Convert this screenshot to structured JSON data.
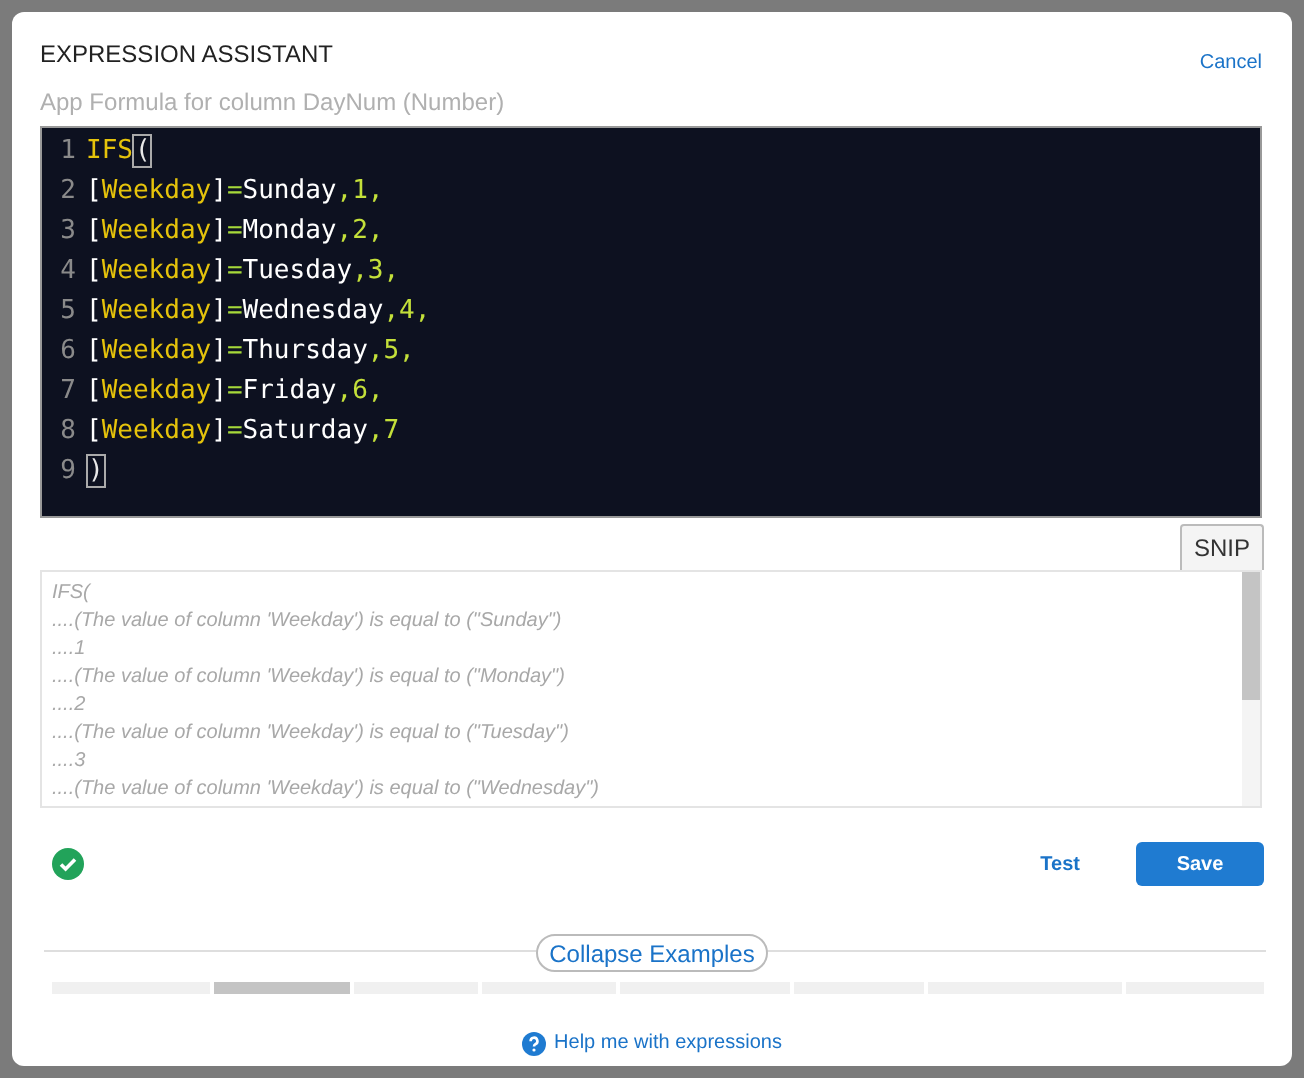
{
  "dialog": {
    "title": "EXPRESSION ASSISTANT",
    "cancel": "Cancel",
    "subtitle": "App Formula for column DayNum (Number)"
  },
  "editor": {
    "lines": [
      {
        "number": "1",
        "tokens": [
          {
            "kind": "function",
            "text": "IFS"
          },
          {
            "kind": "paren",
            "text": "(",
            "highlighted": true
          }
        ]
      },
      {
        "number": "2",
        "tokens": [
          {
            "kind": "plain",
            "text": "["
          },
          {
            "kind": "column",
            "text": "Weekday"
          },
          {
            "kind": "plain",
            "text": "]"
          },
          {
            "kind": "operator",
            "text": "="
          },
          {
            "kind": "plain",
            "text": "Sunday"
          },
          {
            "kind": "number",
            "text": ",1,"
          }
        ]
      },
      {
        "number": "3",
        "tokens": [
          {
            "kind": "plain",
            "text": "["
          },
          {
            "kind": "column",
            "text": "Weekday"
          },
          {
            "kind": "plain",
            "text": "]"
          },
          {
            "kind": "operator",
            "text": "="
          },
          {
            "kind": "plain",
            "text": "Monday"
          },
          {
            "kind": "number",
            "text": ",2,"
          }
        ]
      },
      {
        "number": "4",
        "tokens": [
          {
            "kind": "plain",
            "text": "["
          },
          {
            "kind": "column",
            "text": "Weekday"
          },
          {
            "kind": "plain",
            "text": "]"
          },
          {
            "kind": "operator",
            "text": "="
          },
          {
            "kind": "plain",
            "text": "Tuesday"
          },
          {
            "kind": "number",
            "text": ",3,"
          }
        ]
      },
      {
        "number": "5",
        "tokens": [
          {
            "kind": "plain",
            "text": "["
          },
          {
            "kind": "column",
            "text": "Weekday"
          },
          {
            "kind": "plain",
            "text": "]"
          },
          {
            "kind": "operator",
            "text": "="
          },
          {
            "kind": "plain",
            "text": "Wednesday"
          },
          {
            "kind": "number",
            "text": ",4,"
          }
        ]
      },
      {
        "number": "6",
        "tokens": [
          {
            "kind": "plain",
            "text": "["
          },
          {
            "kind": "column",
            "text": "Weekday"
          },
          {
            "kind": "plain",
            "text": "]"
          },
          {
            "kind": "operator",
            "text": "="
          },
          {
            "kind": "plain",
            "text": "Thursday"
          },
          {
            "kind": "number",
            "text": ",5,"
          }
        ]
      },
      {
        "number": "7",
        "tokens": [
          {
            "kind": "plain",
            "text": "["
          },
          {
            "kind": "column",
            "text": "Weekday"
          },
          {
            "kind": "plain",
            "text": "]"
          },
          {
            "kind": "operator",
            "text": "="
          },
          {
            "kind": "plain",
            "text": "Friday"
          },
          {
            "kind": "number",
            "text": ",6,"
          }
        ]
      },
      {
        "number": "8",
        "tokens": [
          {
            "kind": "plain",
            "text": "["
          },
          {
            "kind": "column",
            "text": "Weekday"
          },
          {
            "kind": "plain",
            "text": "]"
          },
          {
            "kind": "operator",
            "text": "="
          },
          {
            "kind": "plain",
            "text": "Saturday"
          },
          {
            "kind": "number",
            "text": ",7"
          }
        ]
      },
      {
        "number": "9",
        "tokens": [
          {
            "kind": "paren",
            "text": ")",
            "highlighted": true
          }
        ]
      }
    ]
  },
  "snip_button": "SNIP",
  "description": [
    "IFS(",
    "....(The value of column 'Weekday') is equal to (\"Sunday\")",
    "....1",
    "....(The value of column 'Weekday') is equal to (\"Monday\")",
    "....2",
    "....(The value of column 'Weekday') is equal to (\"Tuesday\")",
    "....3",
    "....(The value of column 'Weekday') is equal to (\"Wednesday\")"
  ],
  "status": {
    "valid": true
  },
  "test_button": "Test",
  "save_button": "Save",
  "collapse_examples": "Collapse Examples",
  "help_link": "Help me with expressions"
}
